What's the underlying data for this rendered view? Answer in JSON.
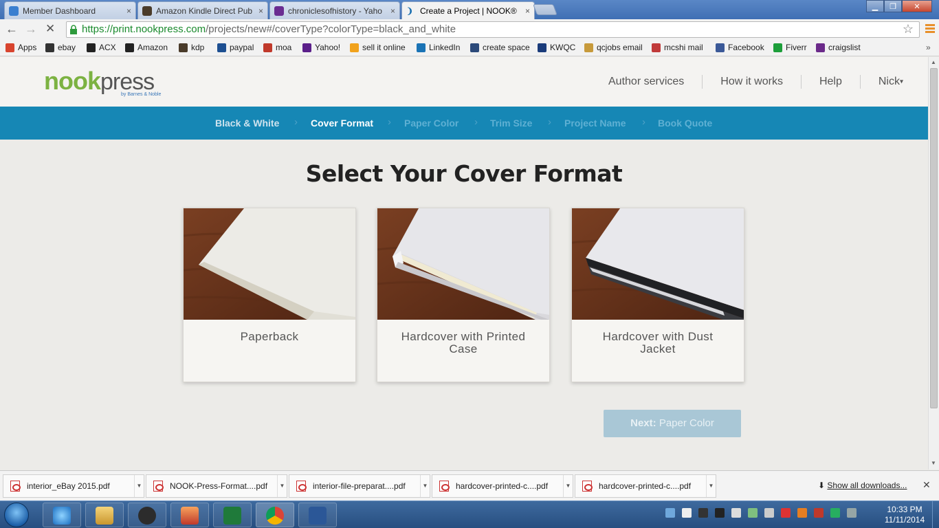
{
  "browser": {
    "tabs": [
      {
        "label": "Member Dashboard",
        "active": false
      },
      {
        "label": "Amazon Kindle Direct Pub",
        "active": false
      },
      {
        "label": "chroniclesofhistory - Yaho",
        "active": false
      },
      {
        "label": "Create a Project | NOOK®",
        "active": true
      }
    ],
    "tab_close_glyph": "×",
    "url_host": "https://print.nookpress.com",
    "url_rest": "/projects/new#/coverType?colorType=black_and_white",
    "bookmarks": [
      {
        "label": "Apps",
        "icon": "apps-grid-icon",
        "color": "#d8442e"
      },
      {
        "label": "ebay",
        "icon": "briefcase-icon",
        "color": "#333333"
      },
      {
        "label": "ACX",
        "icon": "acx-icon",
        "color": "#222222"
      },
      {
        "label": "Amazon",
        "icon": "amazon-icon",
        "color": "#222222"
      },
      {
        "label": "kdp",
        "icon": "kdp-icon",
        "color": "#4a3b2a"
      },
      {
        "label": "paypal",
        "icon": "paypal-icon",
        "color": "#1d4f91"
      },
      {
        "label": "moa",
        "icon": "moa-icon",
        "color": "#c0392b"
      },
      {
        "label": "Yahoo!",
        "icon": "yahoo-icon",
        "color": "#5b1f8a"
      },
      {
        "label": "sell it online",
        "icon": "amazon-smile-icon",
        "color": "#f1a21c"
      },
      {
        "label": "LinkedIn",
        "icon": "linkedin-icon",
        "color": "#1a73b5"
      },
      {
        "label": "create space",
        "icon": "createspace-icon",
        "color": "#2c4a7a"
      },
      {
        "label": "KWQC",
        "icon": "kwqc-icon",
        "color": "#1a3b7a"
      },
      {
        "label": "qcjobs email",
        "icon": "qcjobs-icon",
        "color": "#c79a3b"
      },
      {
        "label": "mcshi mail",
        "icon": "mcshi-icon",
        "color": "#c03a3a"
      },
      {
        "label": "Facebook",
        "icon": "facebook-icon",
        "color": "#3b5998"
      },
      {
        "label": "Fiverr",
        "icon": "fiverr-icon",
        "color": "#1d9e3a"
      },
      {
        "label": "craigslist",
        "icon": "peace-icon",
        "color": "#6b2a8a"
      }
    ],
    "bookmarks_overflow": "»"
  },
  "site": {
    "logo_nook": "nook",
    "logo_press": "press",
    "logo_tagline": "by Barnes & Noble",
    "nav": [
      "Author services",
      "How it works",
      "Help"
    ],
    "user": "Nick",
    "user_caret": "▾"
  },
  "steps": [
    {
      "label": "Black & White",
      "state": "done"
    },
    {
      "label": "Cover Format",
      "state": "current"
    },
    {
      "label": "Paper Color",
      "state": "future"
    },
    {
      "label": "Trim Size",
      "state": "future"
    },
    {
      "label": "Project Name",
      "state": "future"
    },
    {
      "label": "Book Quote",
      "state": "future"
    }
  ],
  "heading": "Select Your Cover Format",
  "cards": [
    {
      "label": "Paperback"
    },
    {
      "label": "Hardcover with Printed Case"
    },
    {
      "label": "Hardcover with Dust Jacket"
    }
  ],
  "next_button": {
    "prefix": "Next:",
    "label": "Paper Color"
  },
  "downloads": [
    {
      "name": "interior_eBay 2015.pdf"
    },
    {
      "name": "NOOK-Press-Format....pdf"
    },
    {
      "name": "interior-file-preparat....pdf"
    },
    {
      "name": "hardcover-printed-c....pdf"
    },
    {
      "name": "hardcover-printed-c....pdf"
    }
  ],
  "show_all_downloads": "Show all downloads...",
  "taskbar": {
    "clock_time": "10:33 PM",
    "clock_date": "11/11/2014"
  },
  "colors": {
    "step_bar": "#1687b5",
    "logo_green": "#7cb242",
    "next_button": "#a9c7d6",
    "url_green": "#1a8a2d"
  }
}
